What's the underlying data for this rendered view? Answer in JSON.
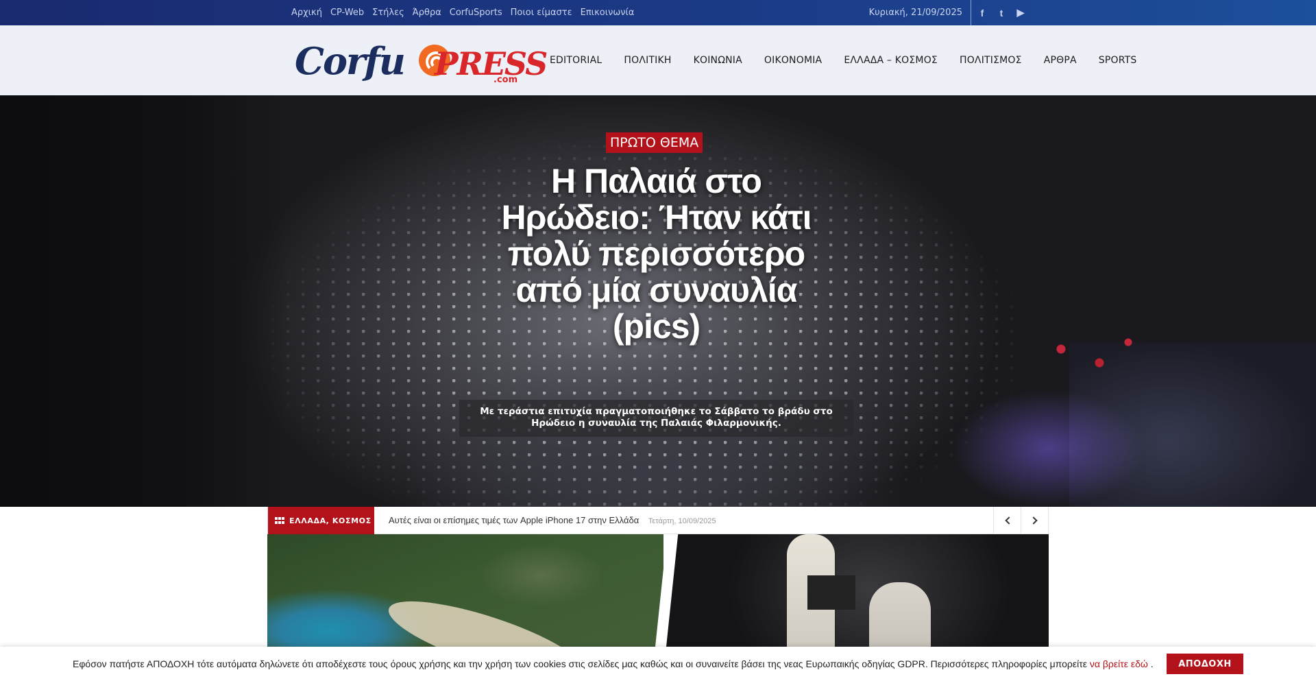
{
  "topbar": {
    "links": [
      "Αρχική",
      "CP-Web",
      "Στήλες",
      "Άρθρα",
      "CorfuSports",
      "Ποιοι είμαστε",
      "Επικοινωνία"
    ],
    "date": "Κυριακή, 21/09/2025",
    "social": [
      {
        "icon": "facebook-icon",
        "glyph": "f"
      },
      {
        "icon": "twitter-icon",
        "glyph": "t"
      },
      {
        "icon": "youtube-icon",
        "glyph": "▶"
      }
    ]
  },
  "header": {
    "logo": {
      "part1": "Corfu",
      "part2": "PRESS",
      "part3": ".com"
    },
    "nav": [
      "EDITORIAL",
      "ΠΟΛΙΤΙΚΗ",
      "ΚΟΙΝΩΝΙΑ",
      "ΟΙΚΟΝΟΜΙΑ",
      "ΕΛΛΑΔΑ – ΚΟΣΜΟΣ",
      "ΠΟΛΙΤΙΣΜΟΣ",
      "ΑΡΘΡΑ",
      "SPORTS"
    ]
  },
  "hero": {
    "badge": "ΠΡΩΤΟ ΘΕΜΑ",
    "title": "Η Παλαιά στο Ηρώδειο: Ήταν κάτι πολύ περισσότερο από μία συναυλία (pics)",
    "subtitle": "Με τεράστια επιτυχία πραγματοποιήθηκε το Σάββατο το βράδυ στο Ηρώδειο η συναυλία της Παλαιάς Φιλαρμονικής."
  },
  "ticker": {
    "label": "ΕΛΛΑΔΑ, ΚΟΣΜΟΣ",
    "headline": "Αυτές είναι οι επίσημες τιμές των Apple iPhone 17 στην Ελλάδα",
    "date": "Τετάρτη, 10/09/2025"
  },
  "cookie": {
    "text": "Εφόσον πατήστε ΑΠΟΔΟΧΗ τότε αυτόματα δηλώνετε ότι αποδέχεστε τους όρους χρήσης και την χρήση των cookies στις σελίδες μας καθώς και οι συναινείτε βάσει της νεας Ευρωπαικής οδηγίας GDPR. Περισσότερες πληροφορίες μπορείτε",
    "link": "να βρείτε εδώ",
    "end": " .",
    "button": "ΑΠΟΔΟΧΗ"
  },
  "colors": {
    "accent": "#b3121a",
    "topbar": "#1b3a86",
    "logo_blue": "#1b2d5e",
    "logo_red": "#d9262b",
    "rss_orange": "#f26a22"
  }
}
